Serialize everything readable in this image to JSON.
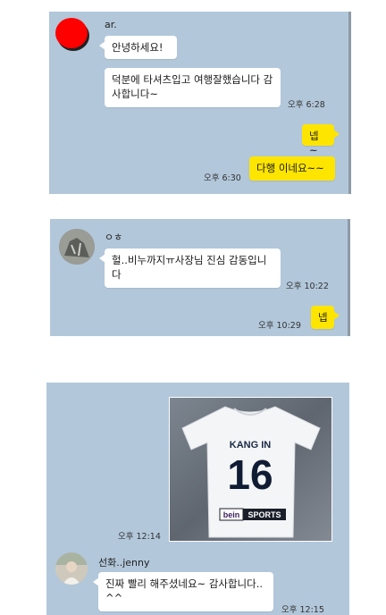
{
  "panel1": {
    "sender": "ar.",
    "messages": [
      {
        "text": "안녕하세요!"
      },
      {
        "text": "덕분에 타셔츠입고 여행잘했습니다 감사합니다~",
        "time": "오후 6:28"
      }
    ],
    "replies": [
      {
        "text": "넵~"
      },
      {
        "text": "다행 이네요~~",
        "time": "오후 6:30"
      }
    ],
    "colors": {
      "avatar": "#ff0000"
    }
  },
  "panel2": {
    "sender": "ㅇㅎ",
    "messages": [
      {
        "text": "헐..비누까지ㅠ사장님 진심 감동입니다",
        "time": "오후 10:22"
      }
    ],
    "replies": [
      {
        "text": "넵",
        "time": "오후 10:29"
      }
    ]
  },
  "panel3": {
    "photo": {
      "jersey_name": "KANG IN",
      "jersey_number": "16",
      "sponsor_brand": "bein",
      "sponsor_sports": "SPORTS",
      "time": "오후 12:14"
    },
    "sender": "선화..jenny",
    "messages": [
      {
        "text": "진짜 빨리 해주셨네요~ 감사합니다.. ^^",
        "time": "오후 12:15"
      }
    ]
  },
  "colors": {
    "chat_background": "#b2c7da",
    "bubble_white": "#ffffff",
    "bubble_yellow": "#fee500"
  }
}
